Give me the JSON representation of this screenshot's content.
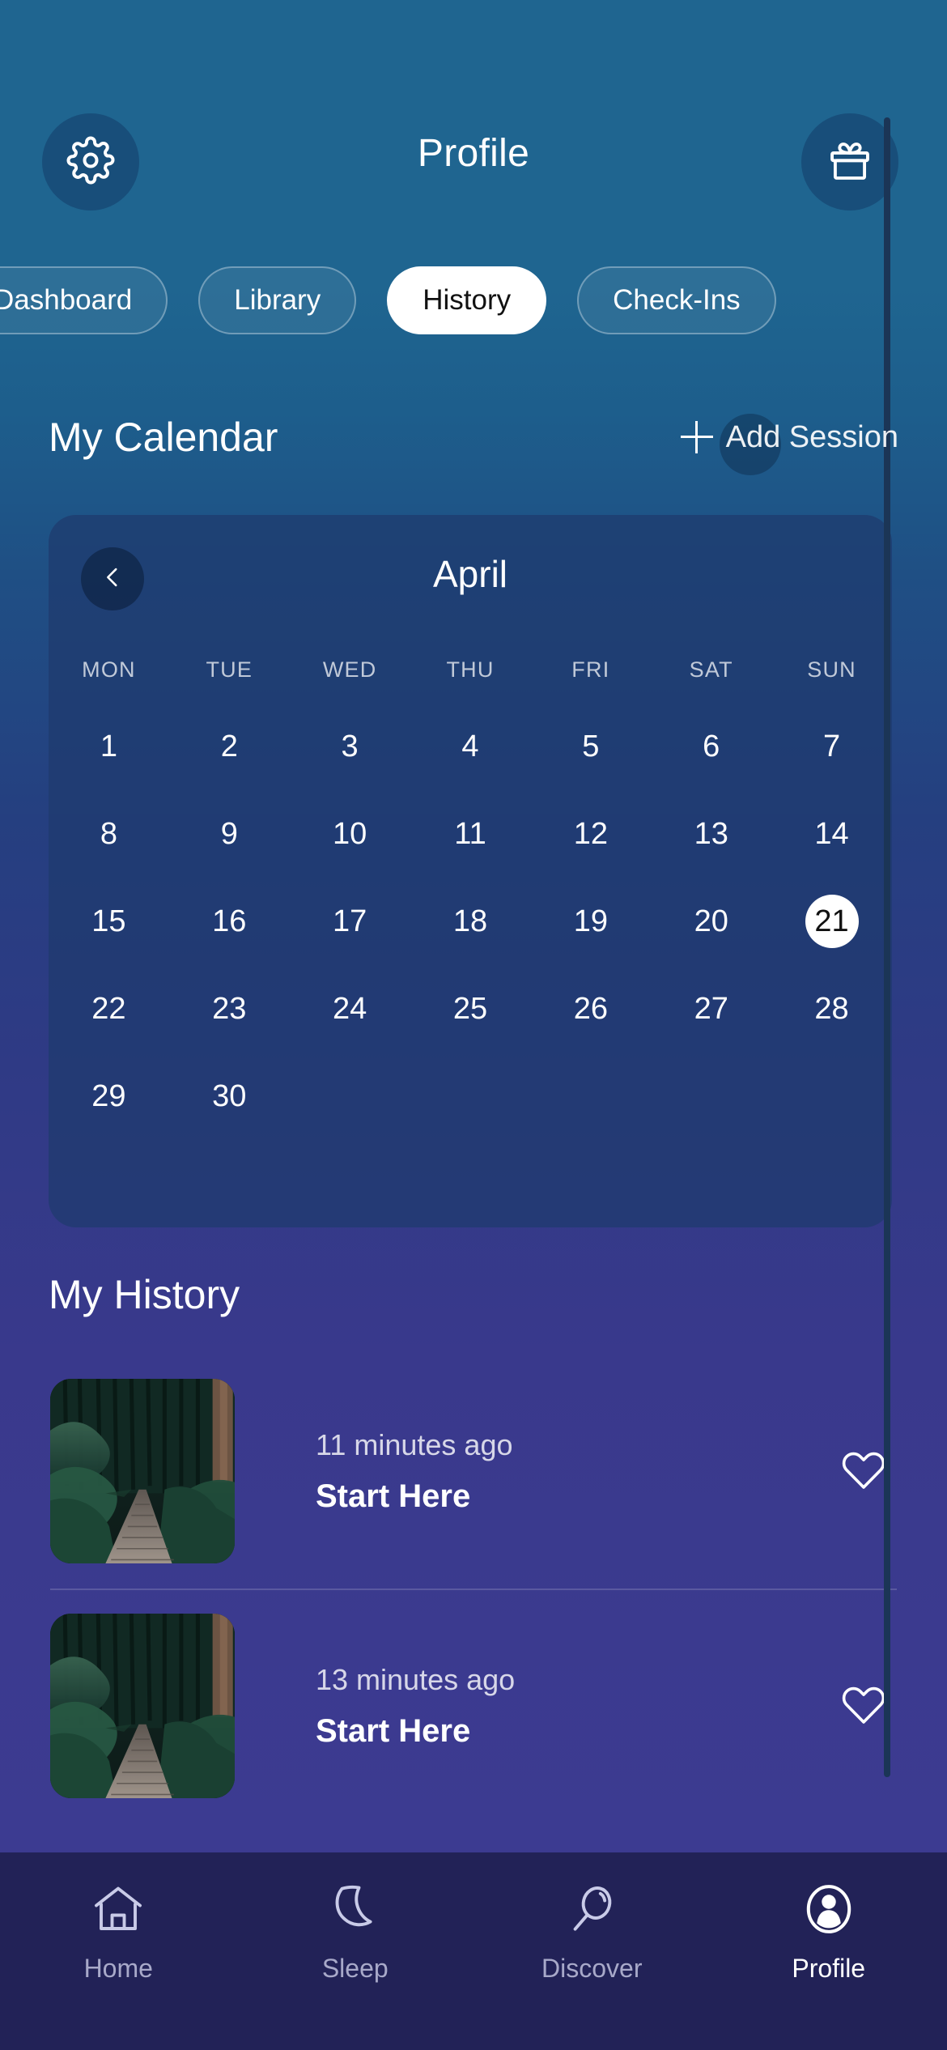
{
  "app": {
    "screen_title": "Profile",
    "background_top_color": "#1f6590",
    "background_bottom_color": "#3c3b91",
    "nav_bar_color": "#222257",
    "calendar_card_color": "#1e3a6e",
    "accent_white": "#ffffff"
  },
  "header": {
    "title": "Profile",
    "settings_icon": "gear-icon",
    "rewards_icon": "gift-icon"
  },
  "tabs": [
    {
      "label": "Dashboard",
      "active": false
    },
    {
      "label": "Library",
      "active": false
    },
    {
      "label": "History",
      "active": true
    },
    {
      "label": "Check-Ins",
      "active": false
    }
  ],
  "calendar_section": {
    "title": "My Calendar",
    "add_button_label": "Add Session",
    "add_button_icon": "plus-icon",
    "prev_month_icon": "chevron-left-icon",
    "month": "April",
    "weekdays": [
      "MON",
      "TUE",
      "WED",
      "THU",
      "FRI",
      "SAT",
      "SUN"
    ],
    "leading_blanks": 0,
    "days": [
      1,
      2,
      3,
      4,
      5,
      6,
      7,
      8,
      9,
      10,
      11,
      12,
      13,
      14,
      15,
      16,
      17,
      18,
      19,
      20,
      21,
      22,
      23,
      24,
      25,
      26,
      27,
      28,
      29,
      30
    ],
    "selected_day": 21
  },
  "history_section": {
    "title": "My History",
    "items": [
      {
        "time": "11 minutes ago",
        "name": "Start Here",
        "thumbnail": "forest-boardwalk-image",
        "favorite_icon": "heart-outline-icon",
        "favorited": false
      },
      {
        "time": "13 minutes ago",
        "name": "Start Here",
        "thumbnail": "forest-boardwalk-image",
        "favorite_icon": "heart-outline-icon",
        "favorited": false
      }
    ]
  },
  "bottom_nav": [
    {
      "label": "Home",
      "icon": "home-icon",
      "active": false
    },
    {
      "label": "Sleep",
      "icon": "moon-icon",
      "active": false
    },
    {
      "label": "Discover",
      "icon": "search-icon",
      "active": false
    },
    {
      "label": "Profile",
      "icon": "person-icon",
      "active": true
    }
  ]
}
